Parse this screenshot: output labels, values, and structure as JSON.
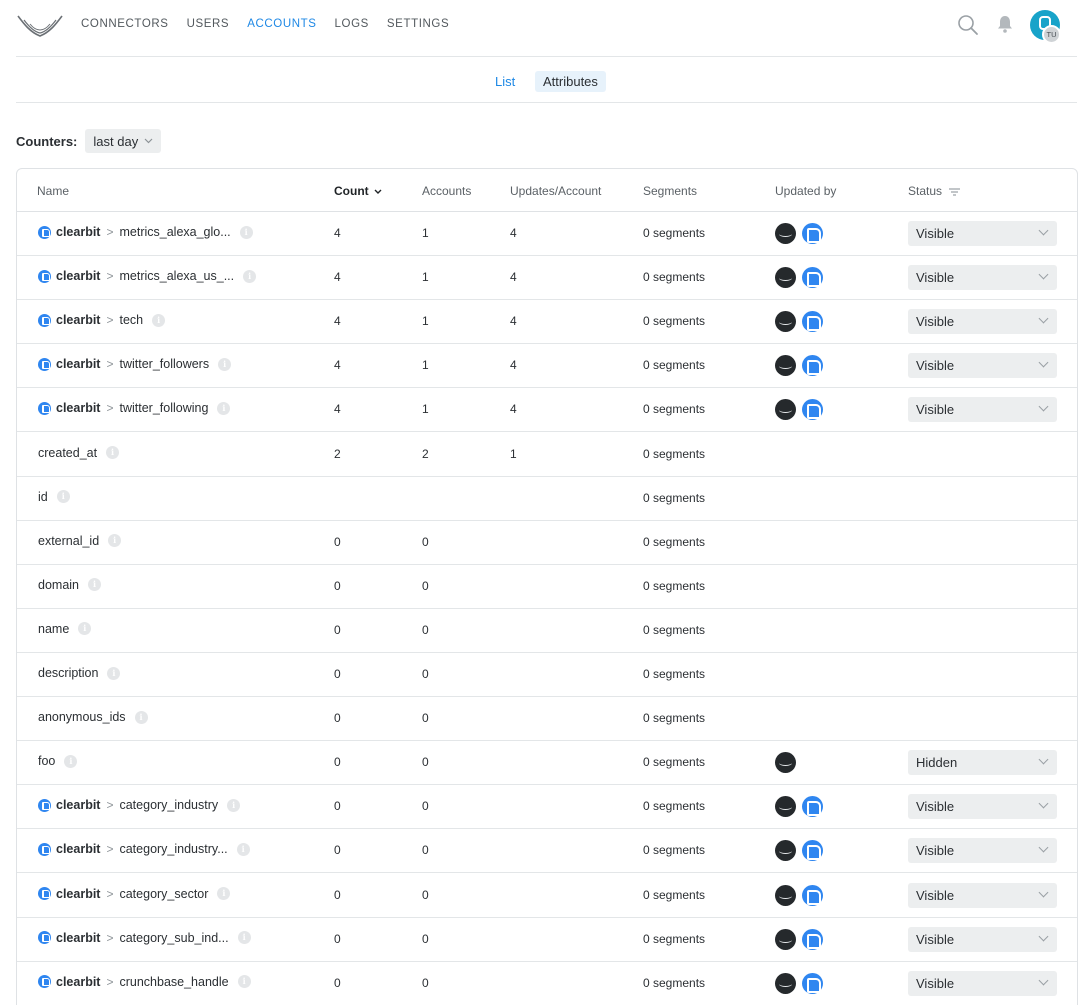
{
  "nav": {
    "items": [
      "CONNECTORS",
      "USERS",
      "ACCOUNTS",
      "LOGS",
      "SETTINGS"
    ],
    "active": "ACCOUNTS"
  },
  "user": {
    "initials": "TU"
  },
  "subtabs": {
    "list": "List",
    "attributes": "Attributes",
    "active": "Attributes"
  },
  "counters": {
    "label": "Counters:",
    "value": "last day"
  },
  "table": {
    "headers": {
      "name": "Name",
      "count": "Count",
      "accounts": "Accounts",
      "updates": "Updates/Account",
      "segments": "Segments",
      "updated_by": "Updated by",
      "status": "Status"
    },
    "rows": [
      {
        "source": "clearbit",
        "name": "metrics_alexa_glo...",
        "count": "4",
        "accounts": "1",
        "updates": "4",
        "segments": "0 segments",
        "updated_by": [
          "hull",
          "clearbit"
        ],
        "status": "Visible"
      },
      {
        "source": "clearbit",
        "name": "metrics_alexa_us_...",
        "count": "4",
        "accounts": "1",
        "updates": "4",
        "segments": "0 segments",
        "updated_by": [
          "hull",
          "clearbit"
        ],
        "status": "Visible"
      },
      {
        "source": "clearbit",
        "name": "tech",
        "count": "4",
        "accounts": "1",
        "updates": "4",
        "segments": "0 segments",
        "updated_by": [
          "hull",
          "clearbit"
        ],
        "status": "Visible"
      },
      {
        "source": "clearbit",
        "name": "twitter_followers",
        "count": "4",
        "accounts": "1",
        "updates": "4",
        "segments": "0 segments",
        "updated_by": [
          "hull",
          "clearbit"
        ],
        "status": "Visible"
      },
      {
        "source": "clearbit",
        "name": "twitter_following",
        "count": "4",
        "accounts": "1",
        "updates": "4",
        "segments": "0 segments",
        "updated_by": [
          "hull",
          "clearbit"
        ],
        "status": "Visible"
      },
      {
        "source": "",
        "name": "created_at",
        "count": "2",
        "accounts": "2",
        "updates": "1",
        "segments": "0 segments",
        "updated_by": [],
        "status": ""
      },
      {
        "source": "",
        "name": "id",
        "count": "",
        "accounts": "",
        "updates": "",
        "segments": "0 segments",
        "updated_by": [],
        "status": ""
      },
      {
        "source": "",
        "name": "external_id",
        "count": "0",
        "accounts": "0",
        "updates": "",
        "segments": "0 segments",
        "updated_by": [],
        "status": ""
      },
      {
        "source": "",
        "name": "domain",
        "count": "0",
        "accounts": "0",
        "updates": "",
        "segments": "0 segments",
        "updated_by": [],
        "status": ""
      },
      {
        "source": "",
        "name": "name",
        "count": "0",
        "accounts": "0",
        "updates": "",
        "segments": "0 segments",
        "updated_by": [],
        "status": ""
      },
      {
        "source": "",
        "name": "description",
        "count": "0",
        "accounts": "0",
        "updates": "",
        "segments": "0 segments",
        "updated_by": [],
        "status": ""
      },
      {
        "source": "",
        "name": "anonymous_ids",
        "count": "0",
        "accounts": "0",
        "updates": "",
        "segments": "0 segments",
        "updated_by": [],
        "status": ""
      },
      {
        "source": "",
        "name": "foo",
        "count": "0",
        "accounts": "0",
        "updates": "",
        "segments": "0 segments",
        "updated_by": [
          "hull"
        ],
        "status": "Hidden"
      },
      {
        "source": "clearbit",
        "name": "category_industry",
        "count": "0",
        "accounts": "0",
        "updates": "",
        "segments": "0 segments",
        "updated_by": [
          "hull",
          "clearbit"
        ],
        "status": "Visible"
      },
      {
        "source": "clearbit",
        "name": "category_industry...",
        "count": "0",
        "accounts": "0",
        "updates": "",
        "segments": "0 segments",
        "updated_by": [
          "hull",
          "clearbit"
        ],
        "status": "Visible"
      },
      {
        "source": "clearbit",
        "name": "category_sector",
        "count": "0",
        "accounts": "0",
        "updates": "",
        "segments": "0 segments",
        "updated_by": [
          "hull",
          "clearbit"
        ],
        "status": "Visible"
      },
      {
        "source": "clearbit",
        "name": "category_sub_ind...",
        "count": "0",
        "accounts": "0",
        "updates": "",
        "segments": "0 segments",
        "updated_by": [
          "hull",
          "clearbit"
        ],
        "status": "Visible"
      },
      {
        "source": "clearbit",
        "name": "crunchbase_handle",
        "count": "0",
        "accounts": "0",
        "updates": "",
        "segments": "0 segments",
        "updated_by": [
          "hull",
          "clearbit"
        ],
        "status": "Visible"
      }
    ]
  },
  "colors": {
    "accent": "#1e88e5",
    "clearbit": "#2f86f0",
    "hull": "#25292c"
  }
}
